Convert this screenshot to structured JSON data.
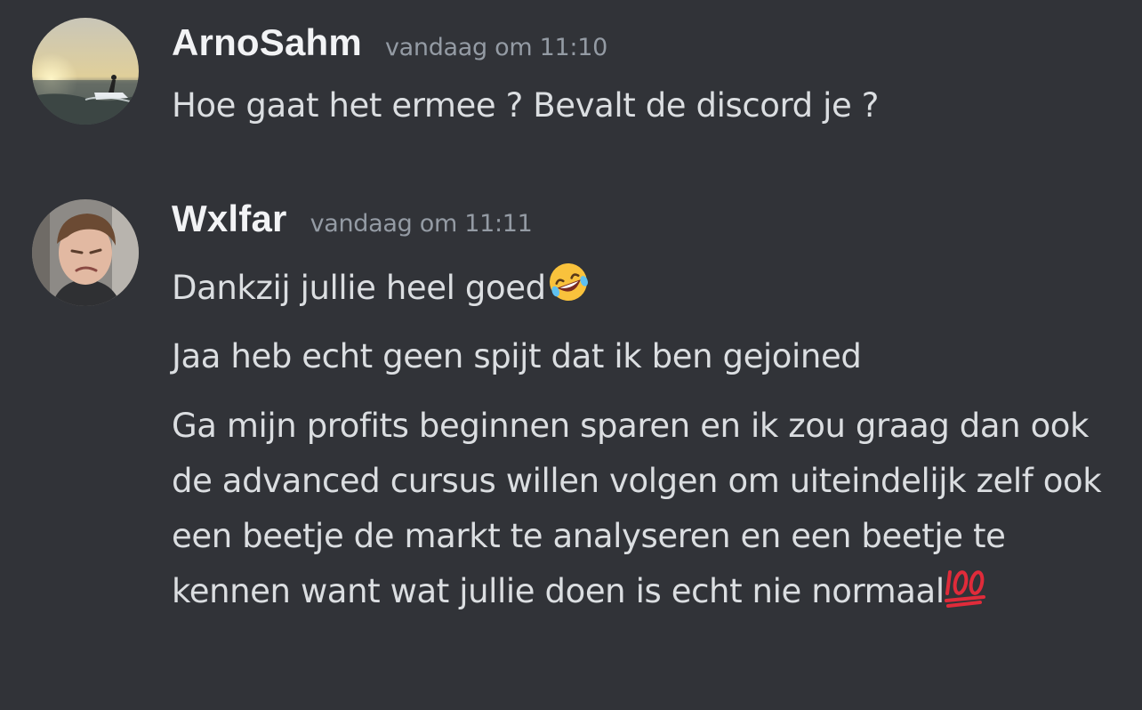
{
  "messages": [
    {
      "author": "ArnoSahm",
      "timestamp": "vandaag om 11:10",
      "avatar_icon": "jetski-sunset-avatar",
      "lines": [
        "Hoe gaat het ermee ? Bevalt de discord je ?"
      ]
    },
    {
      "author": "Wxlfar",
      "timestamp": "vandaag om 11:11",
      "avatar_icon": "person-photo-avatar",
      "lines": [
        "Dankzij jullie heel goed",
        "Jaa heb echt geen spijt dat ik ben gejoined",
        "Ga mijn profits beginnen sparen en ik zou graag dan ook de advanced cursus willen volgen om uiteindelijk zelf ook een beetje de markt te analyseren en een beetje te kennen want wat jullie doen is echt nie normaal"
      ],
      "emojis": [
        "rolling-on-floor-laughing-emoji",
        "hundred-points-emoji"
      ]
    }
  ],
  "colors": {
    "background": "#313338",
    "username": "#f2f3f5",
    "timestamp": "#949ba4",
    "text": "#dbdee1"
  }
}
